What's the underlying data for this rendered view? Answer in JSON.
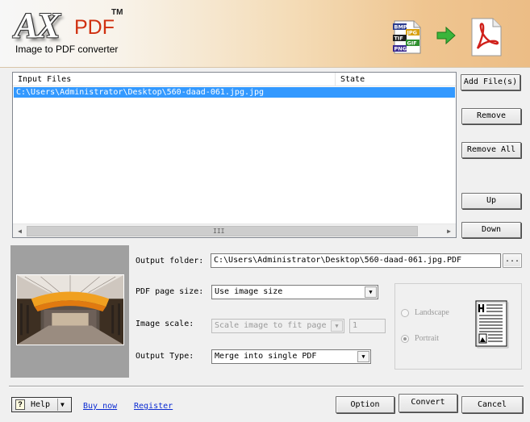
{
  "header": {
    "logo_ax": "AX",
    "logo_pdf": "PDF",
    "logo_tm": "TM",
    "subtitle": "Image to PDF converter",
    "format_icon_labels": [
      "BMP",
      "JPG",
      "TIF",
      "GIF",
      "PNG"
    ]
  },
  "file_list": {
    "columns": [
      "Input Files",
      "State"
    ],
    "rows": [
      {
        "path": "C:\\Users\\Administrator\\Desktop\\560-daad-061.jpg.jpg",
        "state": ""
      }
    ],
    "selected_row": 0
  },
  "side_buttons": {
    "add": "Add File(s)",
    "remove": "Remove",
    "remove_all": "Remove All",
    "up": "Up",
    "down": "Down"
  },
  "settings": {
    "output_folder_label": "Output folder:",
    "output_folder_value": "C:\\Users\\Administrator\\Desktop\\560-daad-061.jpg.PDF",
    "browse_label": "...",
    "page_size_label": "PDF page size:",
    "page_size_value": "Use image size",
    "image_scale_label": "Image scale:",
    "image_scale_value": "Scale image to fit page",
    "image_scale_number": "1",
    "output_type_label": "Output Type:",
    "output_type_value": "Merge into single PDF"
  },
  "orientation": {
    "landscape_label": "Landscape",
    "portrait_label": "Portrait",
    "selected": "portrait",
    "enabled": false
  },
  "footer": {
    "help_label": "Help",
    "buy_link": "Buy now",
    "register_link": "Register",
    "option_label": "Option",
    "convert_label": "Convert",
    "cancel_label": "Cancel"
  },
  "colors": {
    "selection": "#3399ff",
    "link": "#0b2bd2",
    "header_gradient_end": "#ecbd86",
    "logo_pdf": "#d03010",
    "preview_bg": "#a0a0a0"
  }
}
